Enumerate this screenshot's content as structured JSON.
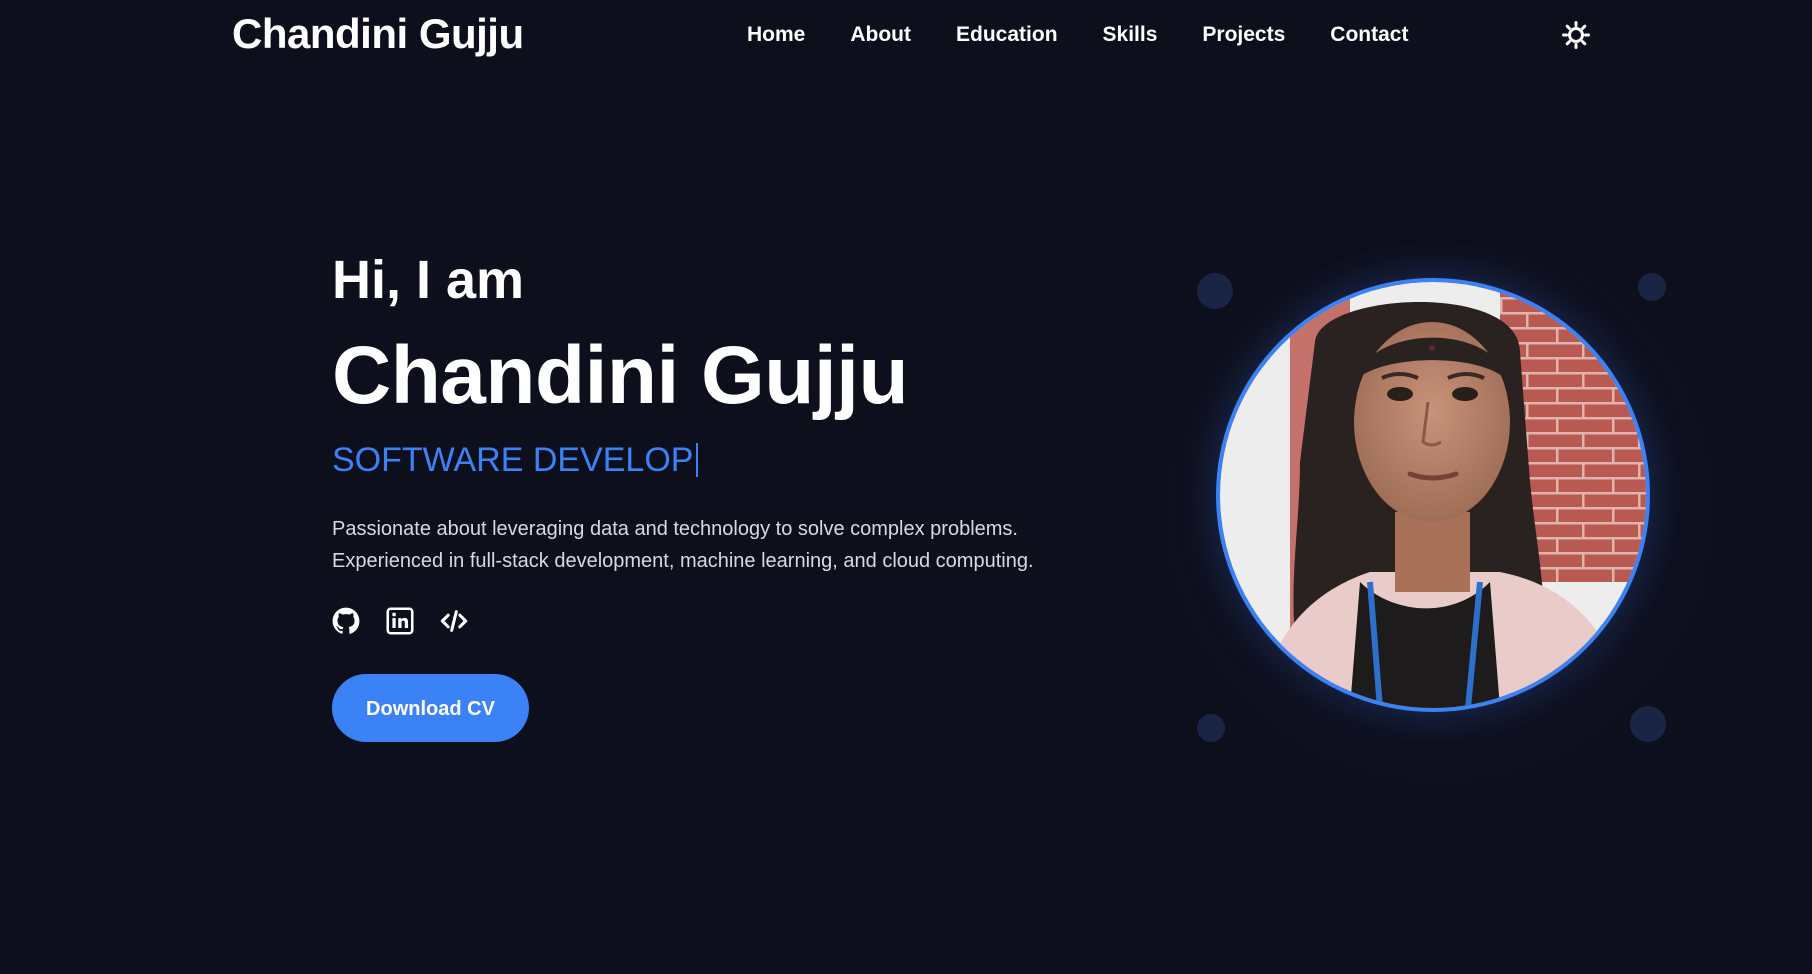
{
  "brand": "Chandini Gujju",
  "nav": {
    "links": [
      "Home",
      "About",
      "Education",
      "Skills",
      "Projects",
      "Contact"
    ]
  },
  "theme_toggle_icon": "sun-icon",
  "hero": {
    "greeting": "Hi, I am",
    "name": "Chandini Gujju",
    "role": "SOFTWARE DEVELOP",
    "description": "Passionate about leveraging data and technology to solve complex problems. Experienced in full-stack development, machine learning, and cloud computing.",
    "social_icons": [
      "github-icon",
      "linkedin-icon",
      "code-icon"
    ],
    "download_label": "Download CV"
  },
  "colors": {
    "background": "#0e0f1c",
    "accent": "#3b82f6",
    "text": "#ffffff"
  }
}
